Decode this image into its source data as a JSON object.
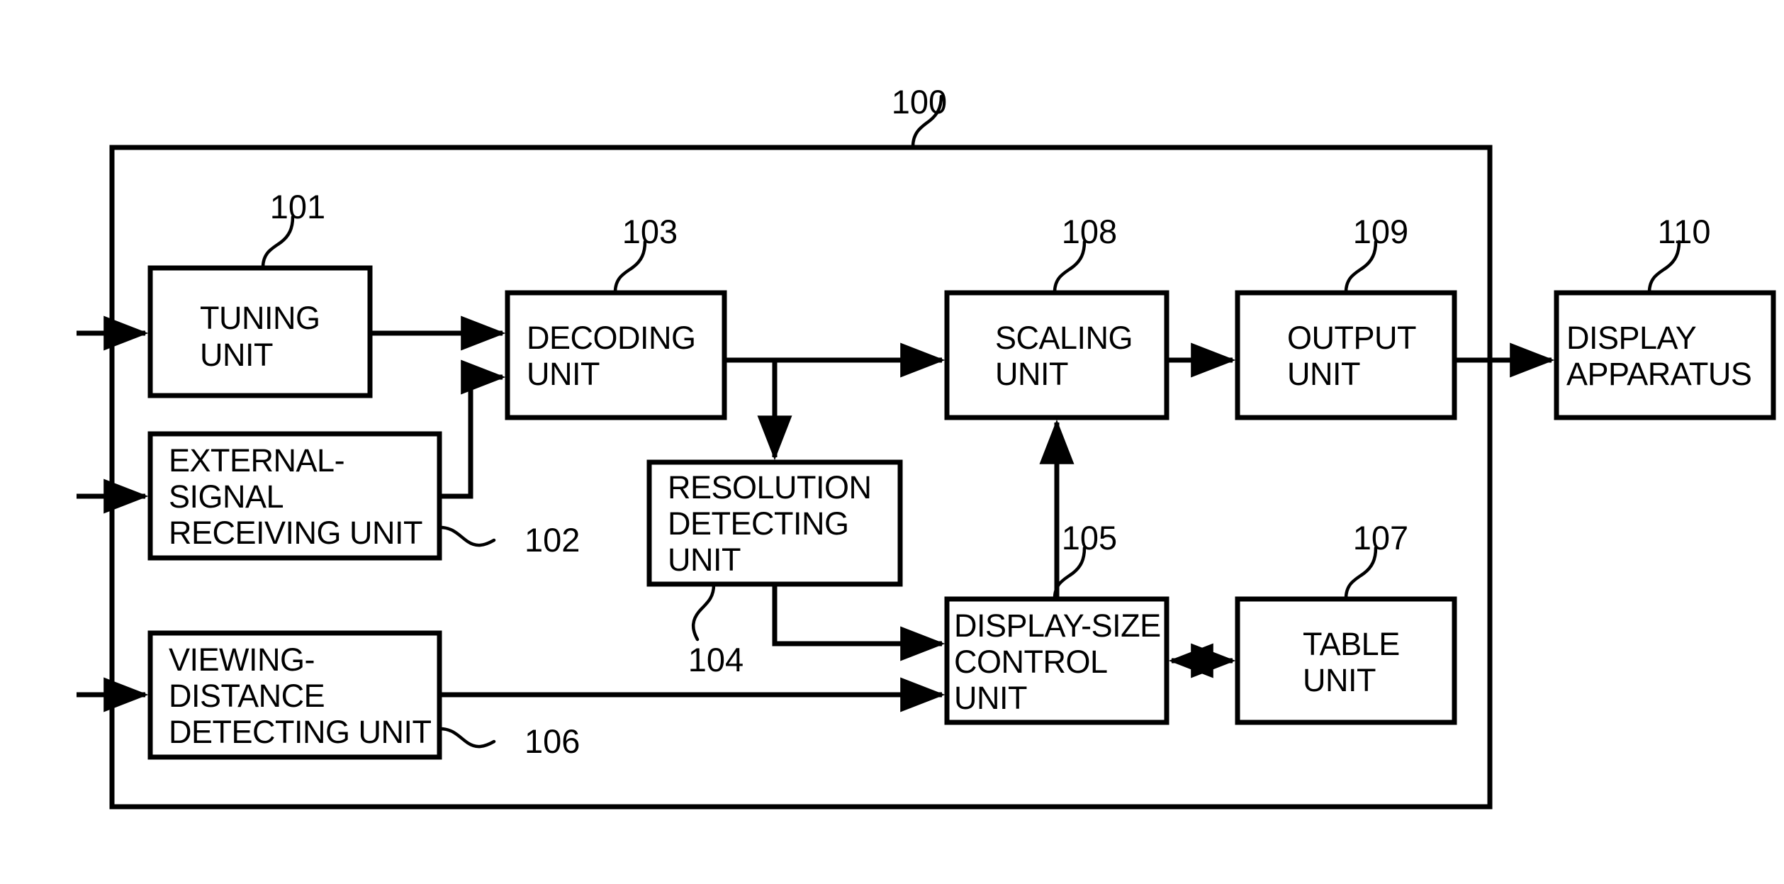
{
  "figure": {
    "type": "patent-block-diagram",
    "system_reference": "100",
    "outer_frame": {
      "label": "100"
    }
  },
  "blocks": [
    {
      "id": "tuning-unit",
      "ref": "101",
      "lines": [
        "TUNING",
        "UNIT"
      ],
      "align": "left"
    },
    {
      "id": "external-signal-receiving-unit",
      "ref": "102",
      "lines": [
        "EXTERNAL-",
        "SIGNAL",
        "RECEIVING UNIT"
      ],
      "align": "left"
    },
    {
      "id": "decoding-unit",
      "ref": "103",
      "lines": [
        "DECODING",
        "UNIT"
      ],
      "align": "left"
    },
    {
      "id": "resolution-detecting-unit",
      "ref": "104",
      "lines": [
        "RESOLUTION",
        "DETECTING",
        "UNIT"
      ],
      "align": "left"
    },
    {
      "id": "display-size-control-unit",
      "ref": "105",
      "lines": [
        "DISPLAY-SIZE",
        "CONTROL",
        "UNIT"
      ],
      "align": "left"
    },
    {
      "id": "viewing-distance-detecting-unit",
      "ref": "106",
      "lines": [
        "VIEWING-",
        "DISTANCE",
        "DETECTING UNIT"
      ],
      "align": "left"
    },
    {
      "id": "table-unit",
      "ref": "107",
      "lines": [
        "TABLE",
        "UNIT"
      ],
      "align": "left"
    },
    {
      "id": "scaling-unit",
      "ref": "108",
      "lines": [
        "SCALING",
        "UNIT"
      ],
      "align": "left"
    },
    {
      "id": "output-unit",
      "ref": "109",
      "lines": [
        "OUTPUT",
        "UNIT"
      ],
      "align": "left"
    },
    {
      "id": "display-apparatus",
      "ref": "110",
      "lines": [
        "DISPLAY",
        "APPARATUS"
      ],
      "align": "left"
    }
  ],
  "labels": {
    "ref_100": "100",
    "ref_101": "101",
    "ref_102": "102",
    "ref_103": "103",
    "ref_104": "104",
    "ref_105": "105",
    "ref_106": "106",
    "ref_107": "107",
    "ref_108": "108",
    "ref_109": "109",
    "ref_110": "110"
  },
  "text": {
    "tuning_l1": "TUNING",
    "tuning_l2": "UNIT",
    "external_l1": "EXTERNAL-",
    "external_l2": "SIGNAL",
    "external_l3": "RECEIVING UNIT",
    "decoding_l1": "DECODING",
    "decoding_l2": "UNIT",
    "resolution_l1": "RESOLUTION",
    "resolution_l2": "DETECTING",
    "resolution_l3": "UNIT",
    "dsc_l1": "DISPLAY-SIZE",
    "dsc_l2": "CONTROL",
    "dsc_l3": "UNIT",
    "viewing_l1": "VIEWING-",
    "viewing_l2": "DISTANCE",
    "viewing_l3": "DETECTING UNIT",
    "table_l1": "TABLE",
    "table_l2": "UNIT",
    "scaling_l1": "SCALING",
    "scaling_l2": "UNIT",
    "output_l1": "OUTPUT",
    "output_l2": "UNIT",
    "display_l1": "DISPLAY",
    "display_l2": "APPARATUS"
  },
  "colors": {
    "stroke": "#000000",
    "background": "#ffffff",
    "fill": "#ffffff"
  }
}
